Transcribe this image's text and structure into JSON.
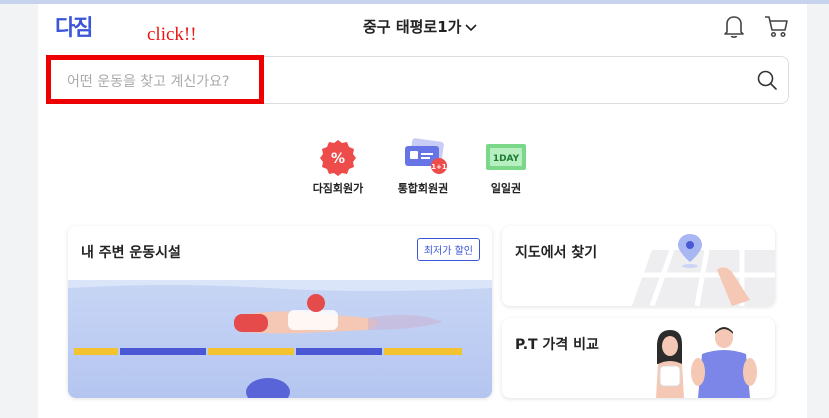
{
  "header": {
    "logo": "다짐",
    "location": "중구 태평로1가"
  },
  "annotation": {
    "click_label": "click!!"
  },
  "search": {
    "placeholder": "어떤 운동을 찾고 계신가요?"
  },
  "categories": [
    {
      "label": "다짐회원가",
      "icon": "percent-badge-icon"
    },
    {
      "label": "통합회원권",
      "icon": "ticket-icon",
      "badge": "1+1"
    },
    {
      "label": "일일권",
      "icon": "one-day-ticket-icon",
      "tag": "1DAY"
    }
  ],
  "cards": {
    "nearby": {
      "title": "내 주변 운동시설",
      "badge": "최저가 할인"
    },
    "map": {
      "title": "지도에서 찾기"
    },
    "pt": {
      "title": "P.T 가격 비교"
    }
  },
  "colors": {
    "brand": "#3b55d9",
    "highlight": "#ee0000",
    "percent_badge": "#ee4b4b",
    "ticket": "#6674e6",
    "one_day": "#7bd88a"
  }
}
